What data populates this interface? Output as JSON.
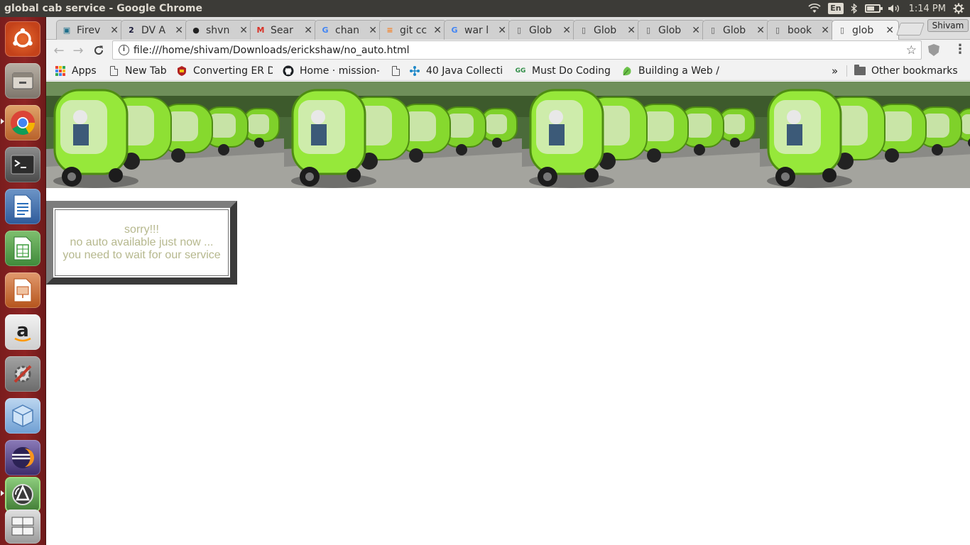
{
  "window": {
    "title": "global cab service - Google Chrome"
  },
  "top_panel": {
    "keyboard_layout": "En",
    "clock": "1:14 PM",
    "indicators": [
      "wifi-icon",
      "keyboard-layout",
      "bluetooth-icon",
      "battery-icon",
      "volume-icon",
      "clock",
      "settings-gear-icon"
    ]
  },
  "launcher": {
    "items": [
      {
        "name": "ubuntu-dash-icon",
        "color": "#e05a1d"
      },
      {
        "name": "files-icon",
        "color": "#8a8178"
      },
      {
        "name": "chrome-icon",
        "color": "#4285f4"
      },
      {
        "name": "terminal-icon",
        "color": "#2d2d2d"
      },
      {
        "name": "libreoffice-writer-icon",
        "color": "#2a6ebb"
      },
      {
        "name": "libreoffice-calc-icon",
        "color": "#3a9b3a"
      },
      {
        "name": "libreoffice-impress-icon",
        "color": "#c4561c"
      },
      {
        "name": "amazon-icon",
        "color": "#e8e8e8"
      },
      {
        "name": "system-settings-icon",
        "color": "#7b7b7b"
      },
      {
        "name": "virtualbox-icon",
        "color": "#7fb0e0"
      },
      {
        "name": "eclipse-icon",
        "color": "#3d2c6b"
      },
      {
        "name": "software-updater-icon",
        "color": "#4f8f3f"
      },
      {
        "name": "workspace-switcher-icon",
        "color": "#bdbdbd"
      }
    ]
  },
  "tabs": [
    {
      "title": "Firev",
      "favicon": "firefox-tab-icon",
      "fav_color": "#1f6f8b",
      "fav_char": "▣"
    },
    {
      "title": "DV A",
      "favicon": "tab-2-icon",
      "fav_color": "#1a1a3a",
      "fav_char": "2"
    },
    {
      "title": "shvn",
      "favicon": "github-icon",
      "fav_color": "#222222",
      "fav_char": "●"
    },
    {
      "title": "Sear",
      "favicon": "gmail-icon",
      "fav_color": "#d93025",
      "fav_char": "M"
    },
    {
      "title": "chan",
      "favicon": "google-icon",
      "fav_color": "#4285f4",
      "fav_char": "G"
    },
    {
      "title": "git cc",
      "favicon": "stackoverflow-icon",
      "fav_color": "#f48024",
      "fav_char": "≡"
    },
    {
      "title": "war l",
      "favicon": "google-icon",
      "fav_color": "#4285f4",
      "fav_char": "G"
    },
    {
      "title": "Glob",
      "favicon": "page-icon",
      "fav_color": "#555555",
      "fav_char": "▯"
    },
    {
      "title": "Glob",
      "favicon": "page-icon",
      "fav_color": "#555555",
      "fav_char": "▯"
    },
    {
      "title": "Glob",
      "favicon": "page-icon",
      "fav_color": "#555555",
      "fav_char": "▯"
    },
    {
      "title": "Glob",
      "favicon": "page-icon",
      "fav_color": "#555555",
      "fav_char": "▯"
    },
    {
      "title": "book",
      "favicon": "page-icon",
      "fav_color": "#555555",
      "fav_char": "▯"
    },
    {
      "title": "glob",
      "favicon": "page-icon",
      "fav_color": "#555555",
      "fav_char": "▯",
      "active": true
    }
  ],
  "profile": {
    "label": "Shivam"
  },
  "omnibox": {
    "url": "file:///home/shivam/Downloads/erickshaw/no_auto.html"
  },
  "bookmarks": {
    "apps_label": "Apps",
    "items": [
      {
        "label": "New Tab",
        "icon": "page-icon"
      },
      {
        "label": "Converting ER D",
        "icon": "er-diagram-icon"
      },
      {
        "label": "Home · mission-",
        "icon": "github-icon"
      },
      {
        "label": "",
        "icon": "page-icon"
      },
      {
        "label": "40 Java Collecti",
        "icon": "java-collections-icon"
      },
      {
        "label": "Must Do Coding",
        "icon": "geeksforgeeks-icon"
      },
      {
        "label": "Building a Web /",
        "icon": "leaf-icon"
      }
    ],
    "overflow_label": "»",
    "other_label": "Other bookmarks"
  },
  "page": {
    "notice_lines": [
      "sorry!!!",
      "no auto available just now ...",
      "you need to wait for our service"
    ],
    "text_color": "#b6b88e"
  }
}
